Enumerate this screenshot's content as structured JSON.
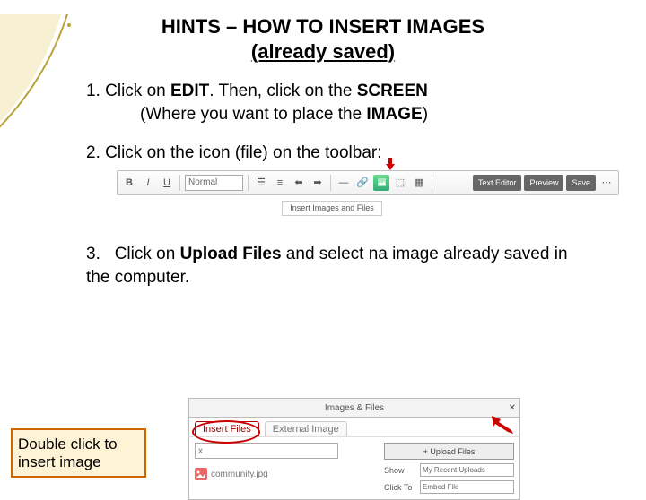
{
  "title": {
    "line1": "HINTS – HOW TO INSERT IMAGES",
    "line2": "(already saved)"
  },
  "steps": {
    "step1": {
      "num": "1.",
      "prefix": "Click on ",
      "bold1": "EDIT",
      "mid": ".  Then, click on the ",
      "bold2": "SCREEN",
      "line2_prefix": "(Where you want to place the ",
      "bold3": "IMAGE",
      "line2_suffix": ")"
    },
    "step2": {
      "num": "2.",
      "text": "Click on the icon (file) on the toolbar:"
    },
    "step3": {
      "num": "3.",
      "prefix": "Click on ",
      "bold": "Upload Files",
      "suffix": "  and select na image already saved in the computer."
    }
  },
  "toolbar": {
    "dropdown_value": "Normal",
    "right_btns": [
      "Text Editor",
      "Preview",
      "Save"
    ],
    "tooltip": "Insert Images and Files"
  },
  "modal": {
    "header": "Images & Files",
    "close": "✕",
    "tab_active": "Insert Files",
    "tab_other": "External Image",
    "search_placeholder": "x",
    "file_name": "community.jpg",
    "upload_btn": "+  Upload Files",
    "row1_label": "Show",
    "row1_value": "My Recent Uploads",
    "row2_label": "Click To",
    "row2_value": "Embed File"
  },
  "callout": "Double click to insert image"
}
